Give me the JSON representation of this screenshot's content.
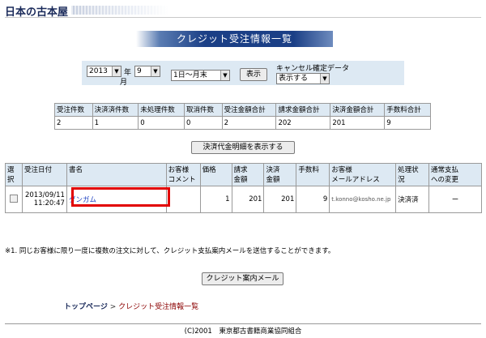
{
  "logo": {
    "text": "日本の古本屋"
  },
  "page_title": "クレジット受注情報一覧",
  "filter": {
    "year": "2013",
    "year_unit": "年",
    "month": "9",
    "month_unit": "月",
    "range": "1日～月末",
    "show_label": "表示",
    "cancel_label": "キャンセル確定データ",
    "cancel_option": "表示する"
  },
  "summary": {
    "headers": [
      "受注件数",
      "決済済件数",
      "未処理件数",
      "取消件数",
      "受注金額合計",
      "請求金額合計",
      "決済金額合計",
      "手数料合計"
    ],
    "values": [
      "2",
      "1",
      "0",
      "0",
      "2",
      "202",
      "201",
      "9"
    ]
  },
  "detail_button": "決済代金明細を表示する",
  "detail_table": {
    "headers": [
      "選択",
      "受注日付",
      "書名",
      "お客様\nコメント",
      "価格",
      "請求\n金額",
      "決済\n金額",
      "手数料",
      "お客様\nメールアドレス",
      "処理状\n況",
      "通常支払\nへの変更"
    ],
    "rows": [
      {
        "date": "2013/09/11",
        "time": "11:20:47",
        "title": "ダンガム",
        "comment": "",
        "price": "1",
        "billing": "201",
        "settlement": "201",
        "fee": "9",
        "email": "t.konno@kosho.ne.jp",
        "status": "決済済",
        "change": "ー"
      }
    ]
  },
  "note": "※1. 同じお客様に限り一度に複数の注文に対して、クレジット支払案内メールを送信することができます。",
  "mail_button": "クレジット案内メール",
  "breadcrumb": {
    "home": "トップページ",
    "sep": ">",
    "current": "クレジット受注情報一覧"
  },
  "footer": "(C)2001　東京都古書籍商業協同組合"
}
